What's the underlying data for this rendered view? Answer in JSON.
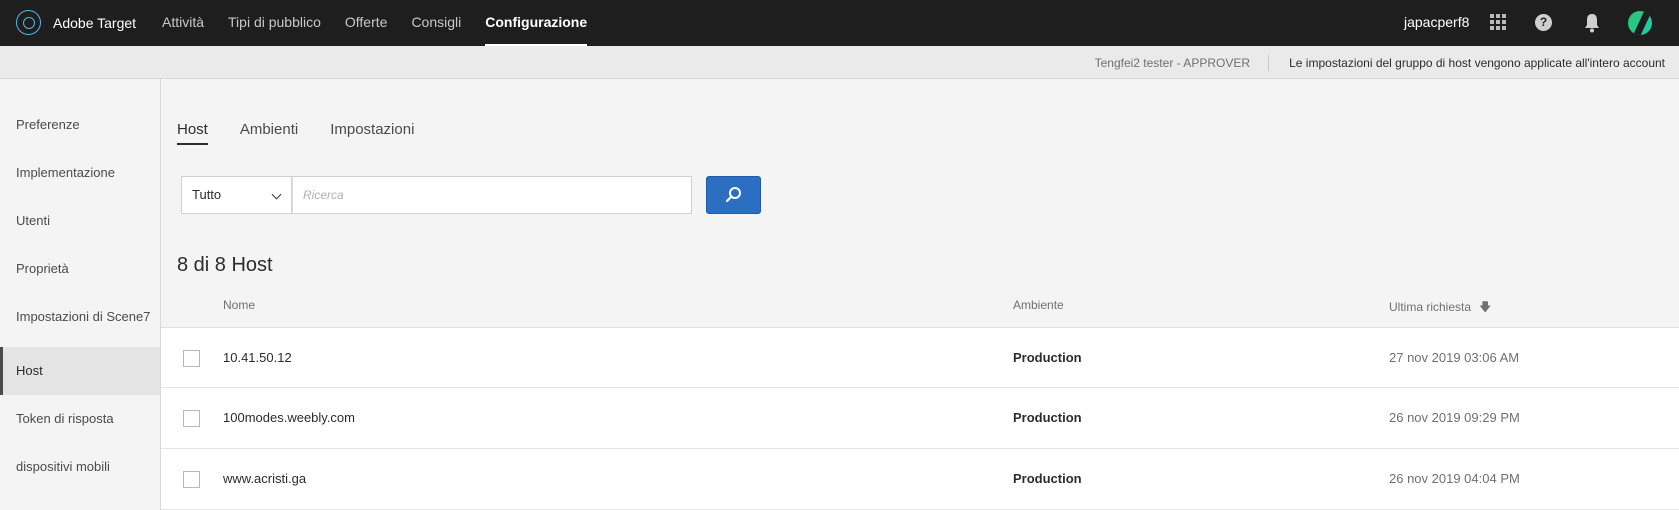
{
  "app": {
    "name": "Adobe Target",
    "nav": [
      {
        "label": "Attività"
      },
      {
        "label": "Tipi di pubblico"
      },
      {
        "label": "Offerte"
      },
      {
        "label": "Consigli"
      },
      {
        "label": "Configurazione"
      }
    ],
    "active_nav": "Configurazione",
    "user": "japacperf8"
  },
  "subbar": {
    "role": "Tengfei2 tester - APPROVER",
    "note": "Le impostazioni del gruppo di host vengono applicate all'intero account"
  },
  "sidebar": {
    "items": [
      {
        "label": "Preferenze"
      },
      {
        "label": "Implementazione"
      },
      {
        "label": "Utenti"
      },
      {
        "label": "Proprietà"
      },
      {
        "label": "Impostazioni di Scene7"
      },
      {
        "label": "Host"
      },
      {
        "label": "Token di risposta"
      },
      {
        "label": "dispositivi mobili"
      }
    ],
    "active": "Host"
  },
  "tabs": [
    {
      "label": "Host"
    },
    {
      "label": "Ambienti"
    },
    {
      "label": "Impostazioni"
    }
  ],
  "active_tab": "Host",
  "filter": {
    "selected": "Tutto"
  },
  "search": {
    "placeholder": "Ricerca",
    "value": ""
  },
  "count_label": "8 di 8 Host",
  "table": {
    "columns": {
      "name": "Nome",
      "env": "Ambiente",
      "last": "Ultima richiesta"
    },
    "rows": [
      {
        "name": "10.41.50.12",
        "env": "Production",
        "last": "27 nov 2019 03:06 AM"
      },
      {
        "name": "100modes.weebly.com",
        "env": "Production",
        "last": "26 nov 2019 09:29 PM"
      },
      {
        "name": "www.acristi.ga",
        "env": "Production",
        "last": "26 nov 2019 04:04 PM"
      }
    ]
  },
  "colors": {
    "topbar": "#1e1e1e",
    "primary": "#2c6ec2",
    "avatar": "#1ccdb6",
    "logo": "#4fb7e6"
  }
}
